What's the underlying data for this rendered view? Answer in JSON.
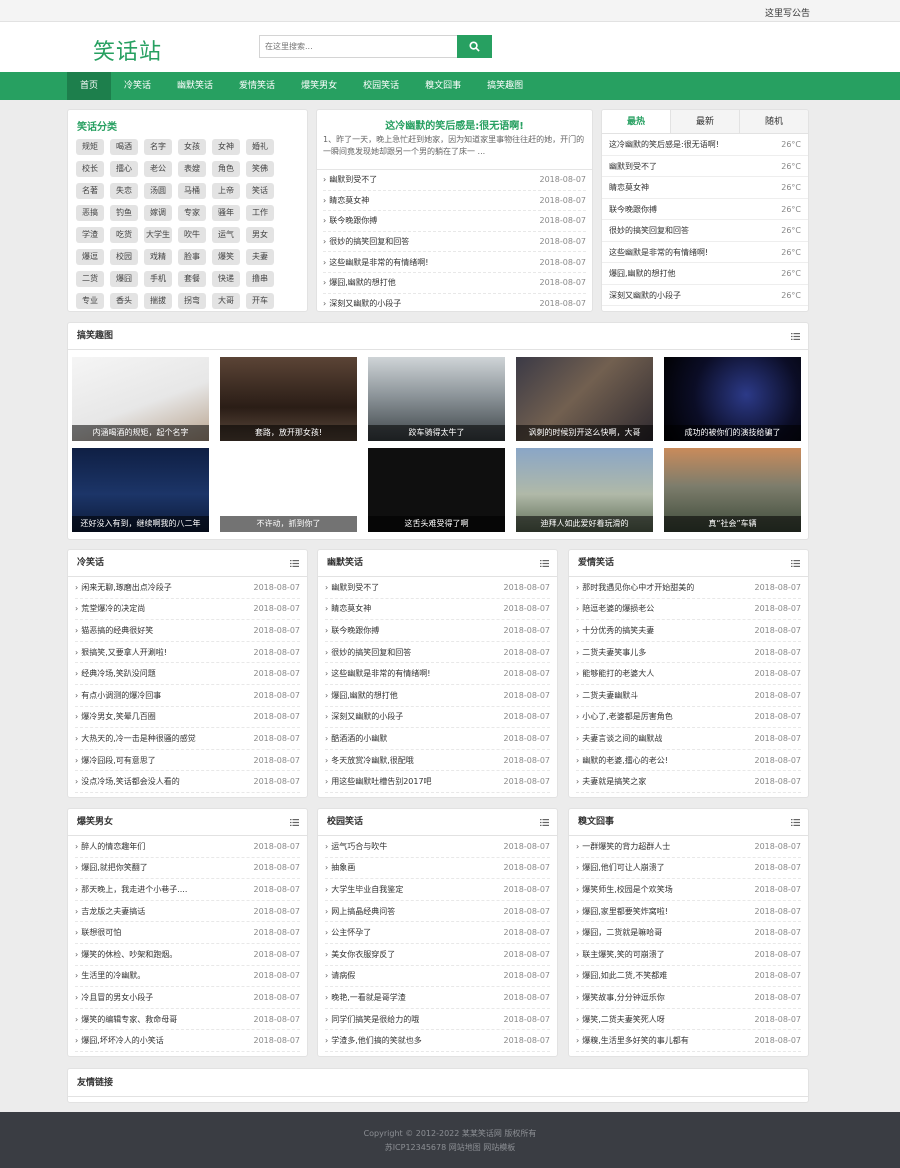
{
  "topbar": {
    "notice": "这里写公告"
  },
  "header": {
    "logo": "笑话站",
    "search_placeholder": "在这里搜索..."
  },
  "nav": [
    "首页",
    "冷笑话",
    "幽默笑话",
    "爱情笑话",
    "爆笑男女",
    "校园笑话",
    "糗文囧事",
    "搞笑趣图"
  ],
  "categories": {
    "title": "笑话分类",
    "tags": [
      "规矩",
      "喝酒",
      "名字",
      "女孩",
      "女神",
      "婚礼",
      "校长",
      "擂心",
      "老公",
      "表嫂",
      "角色",
      "笑佛",
      "名著",
      "失恋",
      "汤圆",
      "马桶",
      "上帝",
      "笑话",
      "恶搞",
      "钓鱼",
      "嫁调",
      "专家",
      "骚年",
      "工作",
      "学渣",
      "吃货",
      "大学生",
      "吹牛",
      "运气",
      "男女",
      "爆逗",
      "校园",
      "戏精",
      "脸事",
      "爆笑",
      "夫妻",
      "二货",
      "爆囧",
      "手机",
      "套餐",
      "快递",
      "撸串",
      "专业",
      "香头",
      "揣拔",
      "拐弯",
      "大哥",
      "开车"
    ]
  },
  "featured": {
    "title": "这冷幽默的笑后感是:很无语啊!",
    "desc": "1、昨了一天，晚上急忙赶到她家，因为知道家里事物往往赶的她，开门的一瞬间竟发现她却跟另一个男的躺在了床一 ...",
    "items": [
      {
        "t": "幽默到受不了",
        "d": "2018-08-07"
      },
      {
        "t": "睛恋莫女神",
        "d": "2018-08-07"
      },
      {
        "t": "联今晚跟你搏",
        "d": "2018-08-07"
      },
      {
        "t": "很妙的搞笑回复和回答",
        "d": "2018-08-07"
      },
      {
        "t": "这些幽默是非常的有情绪啊!",
        "d": "2018-08-07"
      },
      {
        "t": "爆囧,幽默的想打他",
        "d": "2018-08-07"
      },
      {
        "t": "深刻又幽默的小段子",
        "d": "2018-08-07"
      }
    ]
  },
  "hot": {
    "tabs": [
      "最热",
      "最新",
      "随机"
    ],
    "items": [
      {
        "t": "这冷幽默的笑后感是:很无语啊!",
        "d": "26°C"
      },
      {
        "t": "幽默到受不了",
        "d": "26°C"
      },
      {
        "t": "睛恋莫女神",
        "d": "26°C"
      },
      {
        "t": "联今晚跟你搏",
        "d": "26°C"
      },
      {
        "t": "很妙的搞笑回复和回答",
        "d": "26°C"
      },
      {
        "t": "这些幽默是非常的有情绪啊!",
        "d": "26°C"
      },
      {
        "t": "爆囧,幽默的想打他",
        "d": "26°C"
      },
      {
        "t": "深刻又幽默的小段子",
        "d": "26°C"
      }
    ]
  },
  "gallery": {
    "title": "搞笑趣图",
    "items": [
      "内涵喝酒的规矩，起个名字",
      "套路，放开那女孩!",
      "跤车骑得太牛了",
      "讽刺的时候别开这么快啊，大哥",
      "成功的被你们的演技给骗了",
      "还好没入有到，继续啊我的八二年",
      "不许动，抓到你了",
      "这舌头难受得了啊",
      "迪拜人如此爱好着玩滑的",
      "真“社会”车辆"
    ]
  },
  "sections": [
    {
      "title": "冷笑话",
      "items": [
        {
          "t": "闲来无聊,琢磨出点冷段子",
          "d": "2018-08-07"
        },
        {
          "t": "荒堂爆冷的决定尚",
          "d": "2018-08-07"
        },
        {
          "t": "猫恶搞的经典很好笑",
          "d": "2018-08-07"
        },
        {
          "t": "狠搞笑,又要拿人开涮啦!",
          "d": "2018-08-07"
        },
        {
          "t": "经典冷场,笑趴没问题",
          "d": "2018-08-07"
        },
        {
          "t": "有点小调测的爆冷回事",
          "d": "2018-08-07"
        },
        {
          "t": "爆冷男女,笑晕几百圈",
          "d": "2018-08-07"
        },
        {
          "t": "大热天的,冷一击是种很骚的感觉",
          "d": "2018-08-07"
        },
        {
          "t": "爆冷囧段,可有意思了",
          "d": "2018-08-07"
        },
        {
          "t": "没点冷场,笑话都会没人看的",
          "d": "2018-08-07"
        }
      ]
    },
    {
      "title": "幽默笑话",
      "items": [
        {
          "t": "幽默到受不了",
          "d": "2018-08-07"
        },
        {
          "t": "睛恋莫女神",
          "d": "2018-08-07"
        },
        {
          "t": "联今晚跟你搏",
          "d": "2018-08-07"
        },
        {
          "t": "很妙的搞笑回复和回答",
          "d": "2018-08-07"
        },
        {
          "t": "这些幽默是非常的有情绪啊!",
          "d": "2018-08-07"
        },
        {
          "t": "爆囧,幽默的想打他",
          "d": "2018-08-07"
        },
        {
          "t": "深刻又幽默的小段子",
          "d": "2018-08-07"
        },
        {
          "t": "酷酒酒的小幽默",
          "d": "2018-08-07"
        },
        {
          "t": "冬天放赏冷幽默,很配哦",
          "d": "2018-08-07"
        },
        {
          "t": "用这些幽默吐槽告别2017吧",
          "d": "2018-08-07"
        }
      ]
    },
    {
      "title": "爱情笑话",
      "items": [
        {
          "t": "那时我遇见你心中才开始甜美的",
          "d": "2018-08-07"
        },
        {
          "t": "陪逗老婆的爆损老公",
          "d": "2018-08-07"
        },
        {
          "t": "十分优秀的搞笑夫妻",
          "d": "2018-08-07"
        },
        {
          "t": "二货夫妻笑事儿多",
          "d": "2018-08-07"
        },
        {
          "t": "能够能打的老婆大人",
          "d": "2018-08-07"
        },
        {
          "t": "二货夫妻幽默斗",
          "d": "2018-08-07"
        },
        {
          "t": "小心了,老婆都是厉害角色",
          "d": "2018-08-07"
        },
        {
          "t": "夫妻言谈之间的幽默战",
          "d": "2018-08-07"
        },
        {
          "t": "幽默的老婆,擂心的老公!",
          "d": "2018-08-07"
        },
        {
          "t": "夫妻就是搞笑之家",
          "d": "2018-08-07"
        }
      ]
    },
    {
      "title": "爆笑男女",
      "items": [
        {
          "t": "醉人的情恋趣年们",
          "d": "2018-08-07"
        },
        {
          "t": "爆囧,就把你笑翻了",
          "d": "2018-08-07"
        },
        {
          "t": "那天晚上，我走进个小巷子....",
          "d": "2018-08-07"
        },
        {
          "t": "吉龙版之夫妻搞话",
          "d": "2018-08-07"
        },
        {
          "t": "联想很可怕",
          "d": "2018-08-07"
        },
        {
          "t": "爆笑的休检、吵架和跑烟。",
          "d": "2018-08-07"
        },
        {
          "t": "生活里的冷幽默。",
          "d": "2018-08-07"
        },
        {
          "t": "冷且冒的男女小段子",
          "d": "2018-08-07"
        },
        {
          "t": "爆笑的编辑专家、救命母哥",
          "d": "2018-08-07"
        },
        {
          "t": "爆囧,坏坏冷人的小笑话",
          "d": "2018-08-07"
        }
      ]
    },
    {
      "title": "校园笑话",
      "items": [
        {
          "t": "运气巧合与吹牛",
          "d": "2018-08-07"
        },
        {
          "t": "抽象画",
          "d": "2018-08-07"
        },
        {
          "t": "大学生毕业自我鉴定",
          "d": "2018-08-07"
        },
        {
          "t": "网上搞晶经典问答",
          "d": "2018-08-07"
        },
        {
          "t": "公主怀孕了",
          "d": "2018-08-07"
        },
        {
          "t": "美女你衣服穿反了",
          "d": "2018-08-07"
        },
        {
          "t": "请病假",
          "d": "2018-08-07"
        },
        {
          "t": "晚艳,一看就是哥学渣",
          "d": "2018-08-07"
        },
        {
          "t": "同学们搞笑是很给力的哦",
          "d": "2018-08-07"
        },
        {
          "t": "学渣多,他们搞的笑就也多",
          "d": "2018-08-07"
        }
      ]
    },
    {
      "title": "糗文囧事",
      "items": [
        {
          "t": "一群爆笑的背力超群人士",
          "d": "2018-08-07"
        },
        {
          "t": "爆囧,他们可让人崩溃了",
          "d": "2018-08-07"
        },
        {
          "t": "爆笑师生,校园是个欢笑场",
          "d": "2018-08-07"
        },
        {
          "t": "爆囧,家里都要笑炸窝啦!",
          "d": "2018-08-07"
        },
        {
          "t": "爆囧，二货就是嘛哈哥",
          "d": "2018-08-07"
        },
        {
          "t": "联主爆笑,笑的可崩溃了",
          "d": "2018-08-07"
        },
        {
          "t": "爆囧,如此二货,不笑都难",
          "d": "2018-08-07"
        },
        {
          "t": "爆笑故事,分分钟逗乐你",
          "d": "2018-08-07"
        },
        {
          "t": "爆笑,二货夫妻笑死人呀",
          "d": "2018-08-07"
        },
        {
          "t": "爆糗,生活里多好笑的事儿都有",
          "d": "2018-08-07"
        }
      ]
    }
  ],
  "links": {
    "title": "友情链接"
  },
  "footer": {
    "line1": "Copyright © 2012-2022 某某笑话网 版权所有",
    "line2": "苏ICP12345678 网站地图 网站模板"
  }
}
